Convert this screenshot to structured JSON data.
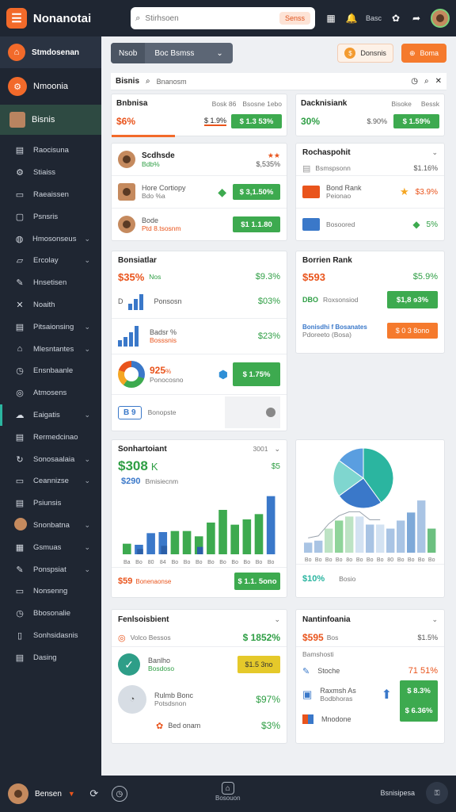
{
  "app": {
    "title": "Nonanotai",
    "search_placeholder": "Stirhsoen",
    "search_button": "Senss"
  },
  "topbar": {
    "icons": [
      "grid-icon",
      "bell-icon",
      "settings-icon",
      "share-icon"
    ],
    "label": "Basc"
  },
  "sidebar": {
    "top": "Stmdosenan",
    "section": "Nmoonia",
    "active": "Bisnis",
    "items": [
      {
        "label": "Raocisuna",
        "icon": "doc-icon",
        "chevron": false
      },
      {
        "label": "Stiaiss",
        "icon": "gear-icon",
        "chevron": false
      },
      {
        "label": "Raeaissen",
        "icon": "card-icon",
        "chevron": false
      },
      {
        "label": "Psnsris",
        "icon": "box-icon",
        "chevron": false
      },
      {
        "label": "Hmosonseus",
        "icon": "globe-icon",
        "chevron": true
      },
      {
        "label": "Ercolay",
        "icon": "chat-icon",
        "chevron": true
      },
      {
        "label": "Hnsetisen",
        "icon": "edit-icon",
        "chevron": false
      },
      {
        "label": "Noaith",
        "icon": "tools-icon",
        "chevron": false
      },
      {
        "label": "Pitsaionsing",
        "icon": "doc-icon",
        "chevron": true
      },
      {
        "label": "Mlesntantes",
        "icon": "bag-icon",
        "chevron": true
      },
      {
        "label": "Ensnbaanle",
        "icon": "clock-icon",
        "chevron": false
      },
      {
        "label": "Atmosens",
        "icon": "at-icon",
        "chevron": false
      },
      {
        "label": "Eaigatis",
        "icon": "cloud-icon",
        "chevron": true
      },
      {
        "label": "Rermedcinao",
        "icon": "doc-icon",
        "chevron": false
      },
      {
        "label": "Sonosaalaia",
        "icon": "refresh-icon",
        "chevron": true
      },
      {
        "label": "Ceannizse",
        "icon": "window-icon",
        "chevron": true
      },
      {
        "label": "Psiunsis",
        "icon": "doc-icon",
        "chevron": false
      },
      {
        "label": "Snonbatna",
        "icon": "avatar-icon",
        "chevron": true
      },
      {
        "label": "Gsmuas",
        "icon": "grid-icon",
        "chevron": true
      },
      {
        "label": "Ponspsiat",
        "icon": "edit-icon",
        "chevron": true
      },
      {
        "label": "Nonsenng",
        "icon": "monitor-icon",
        "chevron": false
      },
      {
        "label": "Bbosonalie",
        "icon": "clock-icon",
        "chevron": false
      },
      {
        "label": "Sonhsidasnis",
        "icon": "phone-icon",
        "chevron": false
      },
      {
        "label": "Dasing",
        "icon": "pages-icon",
        "chevron": false
      }
    ]
  },
  "toolbar": {
    "sel_a": "Nsob",
    "sel_b": "Boc Bsmss",
    "btn1": "Donsnis",
    "btn2": "Boma"
  },
  "subbar": {
    "title": "Bisnis",
    "search": "Bnanosm"
  },
  "kpi1": {
    "title": "Bnbnisa",
    "col1": "Bosk 86",
    "col2": "Bsosne 1ebo",
    "val": "$6%",
    "mid": "$ 1.9%",
    "badge": "$ 1.3 53%"
  },
  "kpi2": {
    "title": "Dacknisiank",
    "col1": "Bisoke",
    "col2": "Bessk",
    "val": "30%",
    "mid": "$.90%",
    "badge": "$ 1.59%"
  },
  "people": {
    "head": {
      "name": "Scdhsde",
      "sub": "Bdb%",
      "val": "$,535%"
    },
    "rows": [
      {
        "name": "Hore Cortiopy",
        "sub": "Bdo %a",
        "badge": "$ 3,1.50%"
      },
      {
        "name": "Bode",
        "sub": "Ptd 8.tsosnm",
        "badge": "$1 1.1.80"
      }
    ]
  },
  "products": {
    "title": "Rochaspohit",
    "head": {
      "name": "Bsmspsonn",
      "val": "$1.16%"
    },
    "rows": [
      {
        "name": "Bond Rank",
        "sub": "Peionao",
        "val": "$3.9%"
      },
      {
        "name": "Bosoored",
        "val": "5%"
      }
    ]
  },
  "mid1": {
    "title": "Bonsiatlar",
    "val": "$35%",
    "tag": "Nos",
    "right": "$9.3%",
    "r1": {
      "letter": "D",
      "label": "Ponsosn",
      "val": "$03%"
    },
    "r2": {
      "title": "Badsr %",
      "sub": "Bosssnis",
      "val": "$23%"
    },
    "r3": {
      "val": "925",
      "unit": "%",
      "sub": "Ponocosno",
      "badge": "$ 1.75%"
    },
    "r4": {
      "label": "B 9",
      "text": "Bonopste"
    }
  },
  "mid2": {
    "title": "Borrien Rank",
    "val": "$593",
    "right": "$5.9%",
    "r1": {
      "tag": "DBO",
      "label": "Roxsonsiod",
      "badge": "$1,8 ɘ3%"
    },
    "r2": {
      "title": "Bonisdhi f Bosanates",
      "sub": "Pdoreeto (Bosa)",
      "btn": "$ 0 3 8ono"
    }
  },
  "chart1": {
    "title": "Sonhartoiant",
    "period": "3001",
    "big": "$308",
    "unit": "K",
    "right": "$5",
    "sub_val": "$290",
    "sub_text": "Bmisiecnm",
    "foot_val": "$59",
    "foot_text": "Bonenaonse",
    "foot_btn": "$ 1.1. 5ono"
  },
  "chart1_data": {
    "type": "bar",
    "categories": [
      "Ba",
      "Bo",
      "80",
      "84",
      "Bo",
      "Bo",
      "Bo",
      "Bo",
      "Bo",
      "Bo",
      "Bo",
      "Bo",
      "Bo"
    ],
    "series": [
      {
        "values": [
          10,
          9,
          20,
          21,
          22,
          22,
          17,
          30,
          42,
          28,
          33,
          38,
          55
        ]
      },
      {
        "values": [
          0,
          5,
          0,
          8,
          0,
          0,
          7,
          0,
          0,
          0,
          0,
          0,
          0
        ]
      }
    ],
    "ylim": [
      0,
      60
    ]
  },
  "chart2": {
    "foot_val": "$10%",
    "foot_text": "Bosio"
  },
  "chart2_data": {
    "type": "bar",
    "categories": [
      "Bo",
      "Bo",
      "Bo",
      "Bo",
      "8o",
      "Bo",
      "Bo",
      "Bo",
      "80",
      "Bo",
      "Bo",
      "Bo",
      "Bo"
    ],
    "series": [
      {
        "values": [
          5,
          6,
          12,
          16,
          18,
          18,
          14,
          14,
          12,
          16,
          20,
          26,
          12
        ]
      }
    ],
    "pie": [
      40,
      25,
      20,
      15
    ],
    "ylim": [
      0,
      30
    ]
  },
  "bot1": {
    "title": "Fenlsoisbient",
    "sub": "Volco Bessos",
    "val": "$ 1852%",
    "r1": {
      "title": "Banlho",
      "sub": "Bosdoso",
      "btn": "$1.5 3no"
    },
    "r2": {
      "title": "Rulmb Bonc",
      "sub": "Potsdsnon",
      "val": "$97%"
    },
    "r3": {
      "label": "Bed onam",
      "val": "$3%"
    }
  },
  "bot2": {
    "title": "Nantinfoania",
    "val": "$595",
    "tag": "Bos",
    "right": "$1.5%",
    "r0": "Bamshosti",
    "r1": {
      "label": "Stoche",
      "val": "71 51%"
    },
    "r2": {
      "title": "Raxmsh As",
      "sub": "Bodbhoras",
      "badge": "$ 8.3%",
      "badge2": "$ 6.36%"
    },
    "r3": {
      "label": "Mnodone"
    }
  },
  "bottom": {
    "user": "Bensen",
    "center": "Bosouon",
    "right": "Bsnisipesa"
  }
}
